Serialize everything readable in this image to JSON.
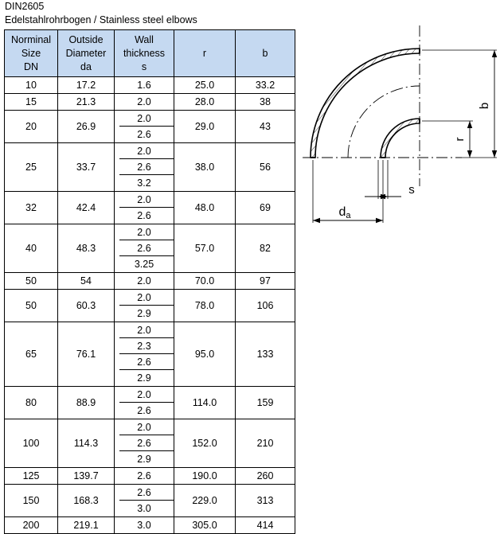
{
  "document": {
    "standard": "DIN2605",
    "subtitle": "Edelstahlrohrbogen / Stainless steel elbows"
  },
  "table": {
    "headers": [
      {
        "key": "dn",
        "label": "Norminal\nSize\nDN"
      },
      {
        "key": "da",
        "label": "Outside\nDiameter\nda"
      },
      {
        "key": "s",
        "label": "Wall\nthickness\ns"
      },
      {
        "key": "r",
        "label": "r"
      },
      {
        "key": "b",
        "label": "b"
      }
    ],
    "rows": [
      {
        "dn": "10",
        "da": "17.2",
        "s": [
          "1.6"
        ],
        "r": "25.0",
        "b": "33.2"
      },
      {
        "dn": "15",
        "da": "21.3",
        "s": [
          "2.0"
        ],
        "r": "28.0",
        "b": "38"
      },
      {
        "dn": "20",
        "da": "26.9",
        "s": [
          "2.0",
          "2.6"
        ],
        "r": "29.0",
        "b": "43"
      },
      {
        "dn": "25",
        "da": "33.7",
        "s": [
          "2.0",
          "2.6",
          "3.2"
        ],
        "r": "38.0",
        "b": "56"
      },
      {
        "dn": "32",
        "da": "42.4",
        "s": [
          "2.0",
          "2.6"
        ],
        "r": "48.0",
        "b": "69"
      },
      {
        "dn": "40",
        "da": "48.3",
        "s": [
          "2.0",
          "2.6",
          "3.25"
        ],
        "r": "57.0",
        "b": "82"
      },
      {
        "dn": "50",
        "da": "54",
        "s": [
          "2.0"
        ],
        "r": "70.0",
        "b": "97"
      },
      {
        "dn": "50",
        "da": "60.3",
        "s": [
          "2.0",
          "2.9"
        ],
        "r": "78.0",
        "b": "106"
      },
      {
        "dn": "65",
        "da": "76.1",
        "s": [
          "2.0",
          "2.3",
          "2.6",
          "2.9"
        ],
        "r": "95.0",
        "b": "133"
      },
      {
        "dn": "80",
        "da": "88.9",
        "s": [
          "2.0",
          "2.6"
        ],
        "r": "114.0",
        "b": "159"
      },
      {
        "dn": "100",
        "da": "114.3",
        "s": [
          "2.0",
          "2.6",
          "2.9"
        ],
        "r": "152.0",
        "b": "210"
      },
      {
        "dn": "125",
        "da": "139.7",
        "s": [
          "2.6"
        ],
        "r": "190.0",
        "b": "260"
      },
      {
        "dn": "150",
        "da": "168.3",
        "s": [
          "2.6",
          "3.0"
        ],
        "r": "229.0",
        "b": "313"
      },
      {
        "dn": "200",
        "da": "219.1",
        "s": [
          "3.0"
        ],
        "r": "305.0",
        "b": "414"
      }
    ]
  },
  "drawing": {
    "title": "90 degree elbow cross-section",
    "dimension_labels": {
      "b": "b",
      "r": "r",
      "s": "s",
      "da_main": "d",
      "da_sub": "a"
    },
    "colors": {
      "line": "#000000",
      "header_fill": "#c5d9f1"
    }
  }
}
